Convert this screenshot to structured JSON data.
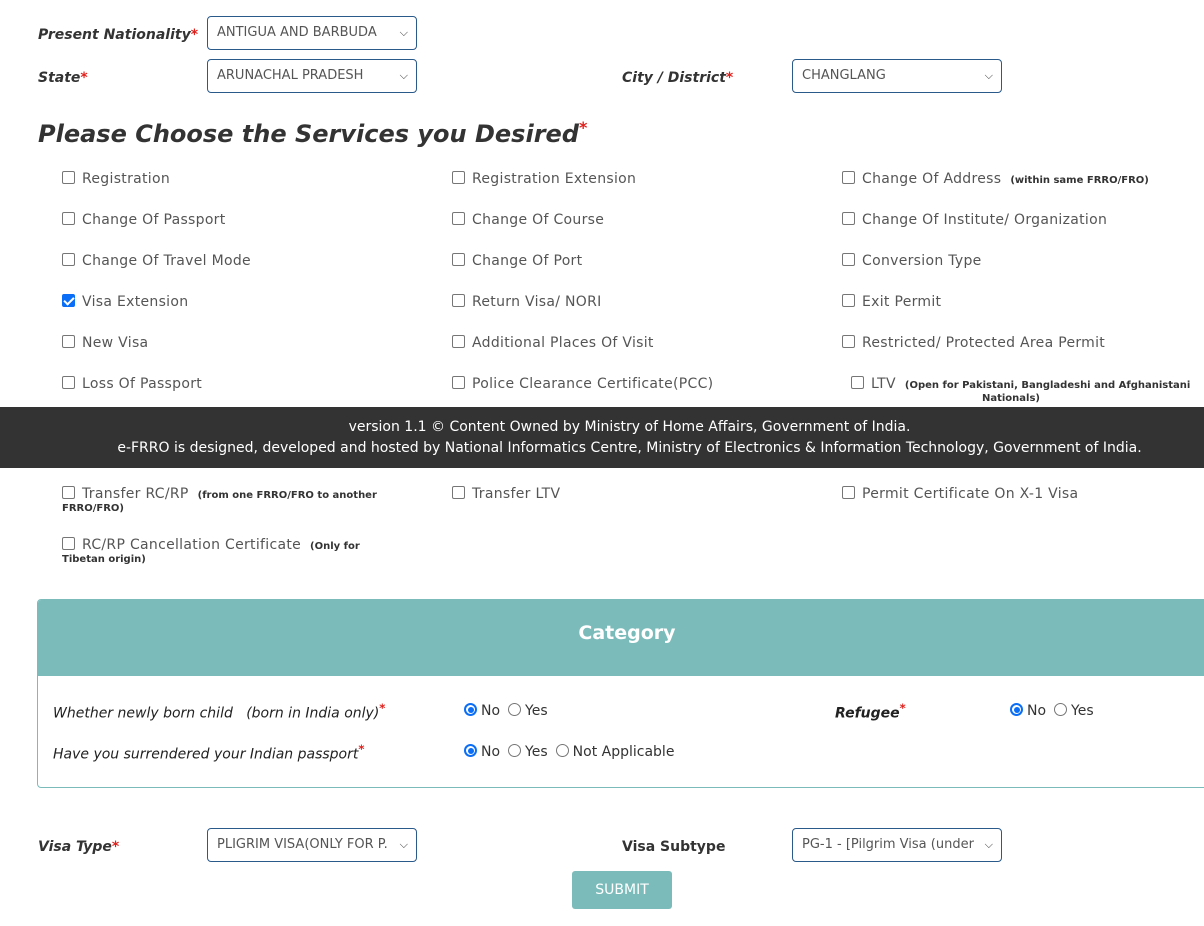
{
  "location": {
    "nationality": {
      "label": "Present Nationality",
      "required_mark": "*",
      "value": "ANTIGUA AND BARBUDA"
    },
    "state": {
      "label": "State",
      "required_mark": "*",
      "value": "ARUNACHAL PRADESH"
    },
    "city": {
      "label": "City / District",
      "required_mark": "*",
      "value": "CHANGLANG"
    }
  },
  "services": {
    "heading": "Please Choose the Services you Desired",
    "required_mark": "*",
    "items": [
      {
        "label": "Registration",
        "note": "",
        "checked": false
      },
      {
        "label": "Registration Extension",
        "note": "",
        "checked": false
      },
      {
        "label": "Change Of Address",
        "note": "(within same FRRO/FRO)",
        "checked": false
      },
      {
        "label": "Change Of Passport",
        "note": "",
        "checked": false
      },
      {
        "label": "Change Of Course",
        "note": "",
        "checked": false
      },
      {
        "label": "Change Of Institute/ Organization",
        "note": "",
        "checked": false
      },
      {
        "label": "Change Of Travel Mode",
        "note": "",
        "checked": false
      },
      {
        "label": "Change Of Port",
        "note": "",
        "checked": false
      },
      {
        "label": "Conversion Type",
        "note": "",
        "checked": false
      },
      {
        "label": "Visa Extension",
        "note": "",
        "checked": true
      },
      {
        "label": "Return Visa/ NORI",
        "note": "",
        "checked": false
      },
      {
        "label": "Exit Permit",
        "note": "",
        "checked": false
      },
      {
        "label": "New Visa",
        "note": "",
        "checked": false
      },
      {
        "label": "Additional Places Of Visit",
        "note": "",
        "checked": false
      },
      {
        "label": "Restricted/ Protected Area Permit",
        "note": "",
        "checked": false
      },
      {
        "label": "Loss Of Passport",
        "note": "",
        "checked": false
      },
      {
        "label": "Police Clearance Certificate(PCC)",
        "note": "",
        "checked": false
      },
      {
        "label": "LTV",
        "note": "(Open for Pakistani, Bangladeshi and Afghanistani",
        "note2": "Nationals)",
        "checked": false
      },
      {
        "label": "Transfer RC/RP",
        "note": "(from one FRRO/FRO to another",
        "note2": "FRRO/FRO)",
        "checked": false
      },
      {
        "label": "Transfer LTV",
        "note": "",
        "checked": false
      },
      {
        "label": "Permit Certificate On X-1 Visa",
        "note": "",
        "checked": false
      },
      {
        "label": "RC/RP Cancellation Certificate",
        "note": "(Only for",
        "note2": "Tibetan origin)",
        "checked": false
      }
    ]
  },
  "footer": {
    "line1": "version 1.1 © Content Owned by Ministry of Home Affairs, Government of India.",
    "line2": "e-FRRO is designed, developed and hosted by National Informatics Centre, Ministry of Electronics & Information Technology, Government of India."
  },
  "category": {
    "title": "Category",
    "newborn": {
      "label": "Whether newly born child   (born in India only)",
      "required_mark": "*",
      "options": [
        "No",
        "Yes"
      ],
      "selected": "No"
    },
    "refugee": {
      "label": "Refugee",
      "required_mark": "*",
      "options": [
        "No",
        "Yes"
      ],
      "selected": "No"
    },
    "surrendered": {
      "label": "Have you surrendered your Indian passport",
      "required_mark": "*",
      "options": [
        "No",
        "Yes",
        "Not Applicable"
      ],
      "selected": "No"
    }
  },
  "visa": {
    "type": {
      "label": "Visa Type",
      "required_mark": "*",
      "value": "PLIGRIM VISA(ONLY FOR P."
    },
    "subtype": {
      "label": "Visa Subtype",
      "value": "PG-1 - [Pilgrim Visa (under"
    }
  },
  "submit_label": "SUBMIT",
  "colors": {
    "accent": "#7bbcbb",
    "footer_bg": "#333333",
    "required": "#e0201c",
    "checkbox_checked": "#0b6ef6",
    "select_border": "#2a5a8a"
  }
}
